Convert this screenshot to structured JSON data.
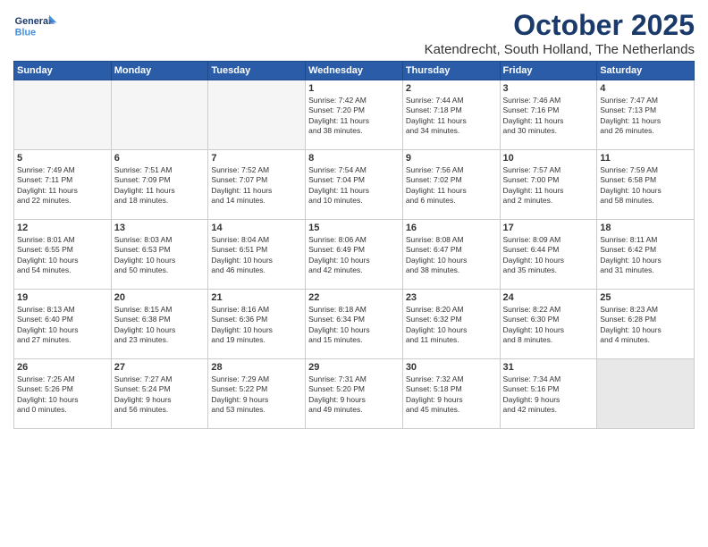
{
  "header": {
    "logo_line1": "General",
    "logo_line2": "Blue",
    "month": "October 2025",
    "location": "Katendrecht, South Holland, The Netherlands"
  },
  "weekdays": [
    "Sunday",
    "Monday",
    "Tuesday",
    "Wednesday",
    "Thursday",
    "Friday",
    "Saturday"
  ],
  "weeks": [
    [
      {
        "day": "",
        "info": "",
        "empty": true
      },
      {
        "day": "",
        "info": "",
        "empty": true
      },
      {
        "day": "",
        "info": "",
        "empty": true
      },
      {
        "day": "1",
        "info": "Sunrise: 7:42 AM\nSunset: 7:20 PM\nDaylight: 11 hours\nand 38 minutes."
      },
      {
        "day": "2",
        "info": "Sunrise: 7:44 AM\nSunset: 7:18 PM\nDaylight: 11 hours\nand 34 minutes."
      },
      {
        "day": "3",
        "info": "Sunrise: 7:46 AM\nSunset: 7:16 PM\nDaylight: 11 hours\nand 30 minutes."
      },
      {
        "day": "4",
        "info": "Sunrise: 7:47 AM\nSunset: 7:13 PM\nDaylight: 11 hours\nand 26 minutes."
      }
    ],
    [
      {
        "day": "5",
        "info": "Sunrise: 7:49 AM\nSunset: 7:11 PM\nDaylight: 11 hours\nand 22 minutes."
      },
      {
        "day": "6",
        "info": "Sunrise: 7:51 AM\nSunset: 7:09 PM\nDaylight: 11 hours\nand 18 minutes."
      },
      {
        "day": "7",
        "info": "Sunrise: 7:52 AM\nSunset: 7:07 PM\nDaylight: 11 hours\nand 14 minutes."
      },
      {
        "day": "8",
        "info": "Sunrise: 7:54 AM\nSunset: 7:04 PM\nDaylight: 11 hours\nand 10 minutes."
      },
      {
        "day": "9",
        "info": "Sunrise: 7:56 AM\nSunset: 7:02 PM\nDaylight: 11 hours\nand 6 minutes."
      },
      {
        "day": "10",
        "info": "Sunrise: 7:57 AM\nSunset: 7:00 PM\nDaylight: 11 hours\nand 2 minutes."
      },
      {
        "day": "11",
        "info": "Sunrise: 7:59 AM\nSunset: 6:58 PM\nDaylight: 10 hours\nand 58 minutes."
      }
    ],
    [
      {
        "day": "12",
        "info": "Sunrise: 8:01 AM\nSunset: 6:55 PM\nDaylight: 10 hours\nand 54 minutes."
      },
      {
        "day": "13",
        "info": "Sunrise: 8:03 AM\nSunset: 6:53 PM\nDaylight: 10 hours\nand 50 minutes."
      },
      {
        "day": "14",
        "info": "Sunrise: 8:04 AM\nSunset: 6:51 PM\nDaylight: 10 hours\nand 46 minutes."
      },
      {
        "day": "15",
        "info": "Sunrise: 8:06 AM\nSunset: 6:49 PM\nDaylight: 10 hours\nand 42 minutes."
      },
      {
        "day": "16",
        "info": "Sunrise: 8:08 AM\nSunset: 6:47 PM\nDaylight: 10 hours\nand 38 minutes."
      },
      {
        "day": "17",
        "info": "Sunrise: 8:09 AM\nSunset: 6:44 PM\nDaylight: 10 hours\nand 35 minutes."
      },
      {
        "day": "18",
        "info": "Sunrise: 8:11 AM\nSunset: 6:42 PM\nDaylight: 10 hours\nand 31 minutes."
      }
    ],
    [
      {
        "day": "19",
        "info": "Sunrise: 8:13 AM\nSunset: 6:40 PM\nDaylight: 10 hours\nand 27 minutes."
      },
      {
        "day": "20",
        "info": "Sunrise: 8:15 AM\nSunset: 6:38 PM\nDaylight: 10 hours\nand 23 minutes."
      },
      {
        "day": "21",
        "info": "Sunrise: 8:16 AM\nSunset: 6:36 PM\nDaylight: 10 hours\nand 19 minutes."
      },
      {
        "day": "22",
        "info": "Sunrise: 8:18 AM\nSunset: 6:34 PM\nDaylight: 10 hours\nand 15 minutes."
      },
      {
        "day": "23",
        "info": "Sunrise: 8:20 AM\nSunset: 6:32 PM\nDaylight: 10 hours\nand 11 minutes."
      },
      {
        "day": "24",
        "info": "Sunrise: 8:22 AM\nSunset: 6:30 PM\nDaylight: 10 hours\nand 8 minutes."
      },
      {
        "day": "25",
        "info": "Sunrise: 8:23 AM\nSunset: 6:28 PM\nDaylight: 10 hours\nand 4 minutes."
      }
    ],
    [
      {
        "day": "26",
        "info": "Sunrise: 7:25 AM\nSunset: 5:26 PM\nDaylight: 10 hours\nand 0 minutes."
      },
      {
        "day": "27",
        "info": "Sunrise: 7:27 AM\nSunset: 5:24 PM\nDaylight: 9 hours\nand 56 minutes."
      },
      {
        "day": "28",
        "info": "Sunrise: 7:29 AM\nSunset: 5:22 PM\nDaylight: 9 hours\nand 53 minutes."
      },
      {
        "day": "29",
        "info": "Sunrise: 7:31 AM\nSunset: 5:20 PM\nDaylight: 9 hours\nand 49 minutes."
      },
      {
        "day": "30",
        "info": "Sunrise: 7:32 AM\nSunset: 5:18 PM\nDaylight: 9 hours\nand 45 minutes."
      },
      {
        "day": "31",
        "info": "Sunrise: 7:34 AM\nSunset: 5:16 PM\nDaylight: 9 hours\nand 42 minutes."
      },
      {
        "day": "",
        "info": "",
        "empty": true,
        "shaded": true
      }
    ]
  ]
}
